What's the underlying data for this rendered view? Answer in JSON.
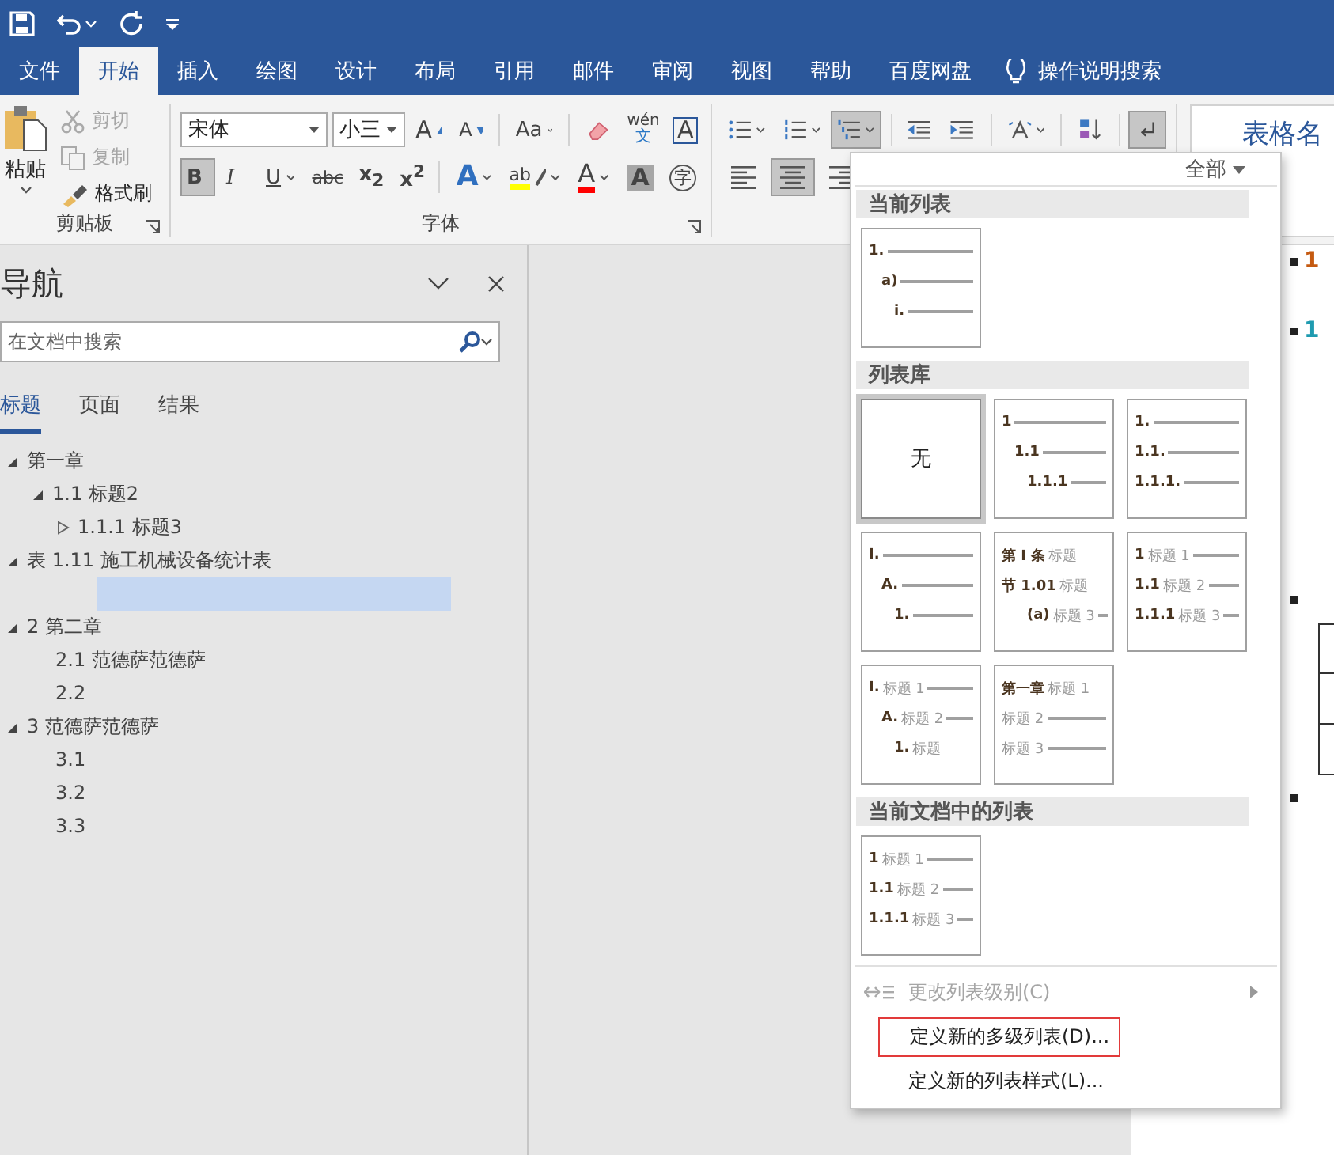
{
  "tabs": [
    {
      "label": "文件",
      "selected": false
    },
    {
      "label": "开始",
      "selected": true
    },
    {
      "label": "插入",
      "selected": false
    },
    {
      "label": "绘图",
      "selected": false
    },
    {
      "label": "设计",
      "selected": false
    },
    {
      "label": "布局",
      "selected": false
    },
    {
      "label": "引用",
      "selected": false
    },
    {
      "label": "邮件",
      "selected": false
    },
    {
      "label": "审阅",
      "selected": false
    },
    {
      "label": "视图",
      "selected": false
    },
    {
      "label": "帮助",
      "selected": false
    },
    {
      "label": "百度网盘",
      "selected": false
    }
  ],
  "tell_me": "操作说明搜索",
  "ribbon": {
    "clipboard": {
      "paste": "粘贴",
      "tools": [
        {
          "kind": "cut",
          "label": "剪切",
          "disabled": true
        },
        {
          "kind": "copy",
          "label": "复制",
          "disabled": true
        },
        {
          "kind": "painter",
          "label": "格式刷",
          "disabled": false
        }
      ],
      "title": "剪贴板"
    },
    "font": {
      "name": "宋体",
      "size": "小三",
      "row_1": [
        {
          "kind": "grow",
          "label": "A"
        },
        {
          "kind": "shrink",
          "label": "A"
        },
        {
          "kind": "case",
          "label": "Aa"
        },
        {
          "kind": "clear"
        },
        {
          "kind": "phonetic",
          "label": "wén",
          "base": "文"
        },
        {
          "kind": "border",
          "label": "A"
        }
      ],
      "row_2": [
        {
          "kind": "bold",
          "label": "B",
          "pressed": true
        },
        {
          "kind": "italic",
          "label": "I",
          "pressed": false
        },
        {
          "kind": "underline",
          "label": "U",
          "pressed": false
        },
        {
          "kind": "strike",
          "label": "abc",
          "pressed": false
        },
        {
          "kind": "sub",
          "label": "x$_{2}$",
          "pressed": false
        },
        {
          "kind": "sup",
          "label": "x$^{2}$",
          "pressed": false
        },
        {
          "kind": "effects",
          "label": "A",
          "pressed": false
        },
        {
          "kind": "highlight",
          "label": "ab",
          "pressed": false
        },
        {
          "kind": "color",
          "label": "A",
          "pressed": false
        },
        {
          "kind": "shade",
          "label": "A",
          "pressed": false
        },
        {
          "kind": "enclose",
          "label": "字",
          "pressed": false
        }
      ],
      "title": "字体"
    },
    "paragraph": {
      "row_1": [
        {
          "kind": "bullets",
          "pressed": false
        },
        {
          "kind": "numbering",
          "pressed": false
        },
        {
          "kind": "multilevel",
          "pressed": true
        },
        {
          "kind": "outdent",
          "pressed": false
        },
        {
          "kind": "indent",
          "pressed": false
        },
        {
          "kind": "layout",
          "pressed": false
        },
        {
          "kind": "sort",
          "pressed": false
        },
        {
          "kind": "marks",
          "pressed": true
        }
      ],
      "row_2": [
        {
          "kind": "left",
          "pressed": false
        },
        {
          "kind": "center",
          "pressed": true
        },
        {
          "kind": "right",
          "pressed": false
        }
      ]
    },
    "styles": {
      "preview": "表格名"
    }
  },
  "navigation": {
    "title": "导航",
    "search": {
      "placeholder": "在文档中搜索"
    },
    "tabs": [
      {
        "label": "标题",
        "selected": true
      },
      {
        "label": "页面",
        "selected": false
      },
      {
        "label": "结果",
        "selected": false
      }
    ],
    "tree": [
      {
        "label": "第一章",
        "selected": false,
        "expanded": true,
        "children": [
          {
            "label": "1.1 标题2",
            "selected": false,
            "expanded": true,
            "children": [
              {
                "label": "1.1.1 标题3",
                "selected": false,
                "expanded": false
              }
            ]
          }
        ]
      },
      {
        "label": "表 1.11 施工机械设备统计表",
        "selected": false,
        "expanded": true,
        "children": [
          {
            "selected": true
          }
        ]
      },
      {
        "label": "2 第二章",
        "selected": false,
        "expanded": true,
        "children": [
          {
            "label": "2.1 范德萨范德萨",
            "selected": false
          },
          {
            "label": "2.2",
            "selected": false
          }
        ]
      },
      {
        "label": "3 范德萨范德萨",
        "selected": false,
        "expanded": true,
        "children": [
          {
            "label": "3.1",
            "selected": false
          },
          {
            "label": "3.2",
            "selected": false
          },
          {
            "label": "3.3",
            "selected": false
          }
        ]
      }
    ]
  },
  "document": {
    "blocks": [
      {
        "kind": "heading",
        "label": "1",
        "color": "#c55a11"
      },
      {
        "kind": "heading",
        "label": "1",
        "color": "#1f9bb0"
      },
      {
        "kind": "bullet"
      },
      {
        "kind": "table"
      },
      {
        "kind": "bullet"
      }
    ]
  },
  "list_menu": {
    "filter": "全部",
    "sections": [
      {
        "title": "当前列表",
        "thumbnails": [
          {
            "kind": "list",
            "selected": false,
            "lines": [
              {
                "label": "1.",
                "indented": false,
                "rule": true
              },
              {
                "label": "a)",
                "indented": true,
                "rule": true
              },
              {
                "label": "i.",
                "indented": true,
                "rule": true
              }
            ]
          }
        ]
      },
      {
        "title": "列表库",
        "thumbnails": [
          {
            "kind": "none",
            "label": "无",
            "selected": true
          },
          {
            "kind": "list",
            "selected": false,
            "lines": [
              {
                "label": "1",
                "indented": false,
                "rule": true
              },
              {
                "label": "1.1",
                "indented": true,
                "rule": true
              },
              {
                "label": "1.1.1",
                "indented": true,
                "rule": true
              }
            ]
          },
          {
            "kind": "list",
            "selected": false,
            "lines": [
              {
                "label": "1.",
                "indented": false,
                "rule": true
              },
              {
                "label": "1.1.",
                "indented": false,
                "rule": true
              },
              {
                "label": "1.1.1.",
                "indented": false,
                "rule": true
              }
            ]
          },
          {
            "kind": "list",
            "selected": false,
            "lines": [
              {
                "label": "I.",
                "indented": false,
                "rule": true
              },
              {
                "label": "A.",
                "indented": true,
                "rule": true
              },
              {
                "label": "1.",
                "indented": true,
                "rule": true
              }
            ]
          },
          {
            "kind": "list",
            "selected": false,
            "lines": [
              {
                "label": "第 I 条",
                "caption": "标题",
                "indented": false,
                "rule": false
              },
              {
                "label": "节 1.01",
                "caption": "标题",
                "indented": false,
                "rule": false
              },
              {
                "label": "(a)",
                "caption": "标题 3",
                "indented": true,
                "rule": true
              }
            ]
          },
          {
            "kind": "list",
            "selected": false,
            "lines": [
              {
                "label": "1",
                "caption": "标题 1",
                "indented": false,
                "rule": true
              },
              {
                "label": "1.1",
                "caption": "标题 2",
                "indented": false,
                "rule": true
              },
              {
                "label": "1.1.1",
                "caption": "标题 3",
                "indented": false,
                "rule": true
              }
            ]
          },
          {
            "kind": "list",
            "selected": false,
            "lines": [
              {
                "label": "I.",
                "caption": "标题 1",
                "indented": false,
                "rule": true
              },
              {
                "label": "A.",
                "caption": "标题 2",
                "indented": true,
                "rule": true
              },
              {
                "label": "1.",
                "caption": "标题",
                "indented": true,
                "rule": false
              }
            ]
          },
          {
            "kind": "list",
            "selected": false,
            "lines": [
              {
                "label": "第一章",
                "caption": "标题 1",
                "indented": false,
                "rule": false
              },
              {
                "caption": "标题 2",
                "indented": false,
                "rule": true
              },
              {
                "caption": "标题 3",
                "indented": false,
                "rule": true
              }
            ]
          }
        ]
      },
      {
        "title": "当前文档中的列表",
        "thumbnails": [
          {
            "kind": "list",
            "selected": false,
            "lines": [
              {
                "label": "1",
                "caption": "标题 1",
                "indented": false,
                "rule": true
              },
              {
                "label": "1.1",
                "caption": "标题 2",
                "indented": false,
                "rule": true
              },
              {
                "label": "1.1.1",
                "caption": "标题 3",
                "indented": false,
                "rule": true
              }
            ]
          }
        ]
      }
    ],
    "items": [
      {
        "kind": "level",
        "label": "更改列表级别(C)",
        "disabled": true,
        "submenu": true,
        "outlined": false
      },
      {
        "kind": "command",
        "label": "定义新的多级列表(D)...",
        "disabled": false,
        "submenu": false,
        "outlined": true
      },
      {
        "kind": "command",
        "label": "定义新的列表样式(L)...",
        "disabled": false,
        "submenu": false,
        "outlined": false
      }
    ]
  }
}
